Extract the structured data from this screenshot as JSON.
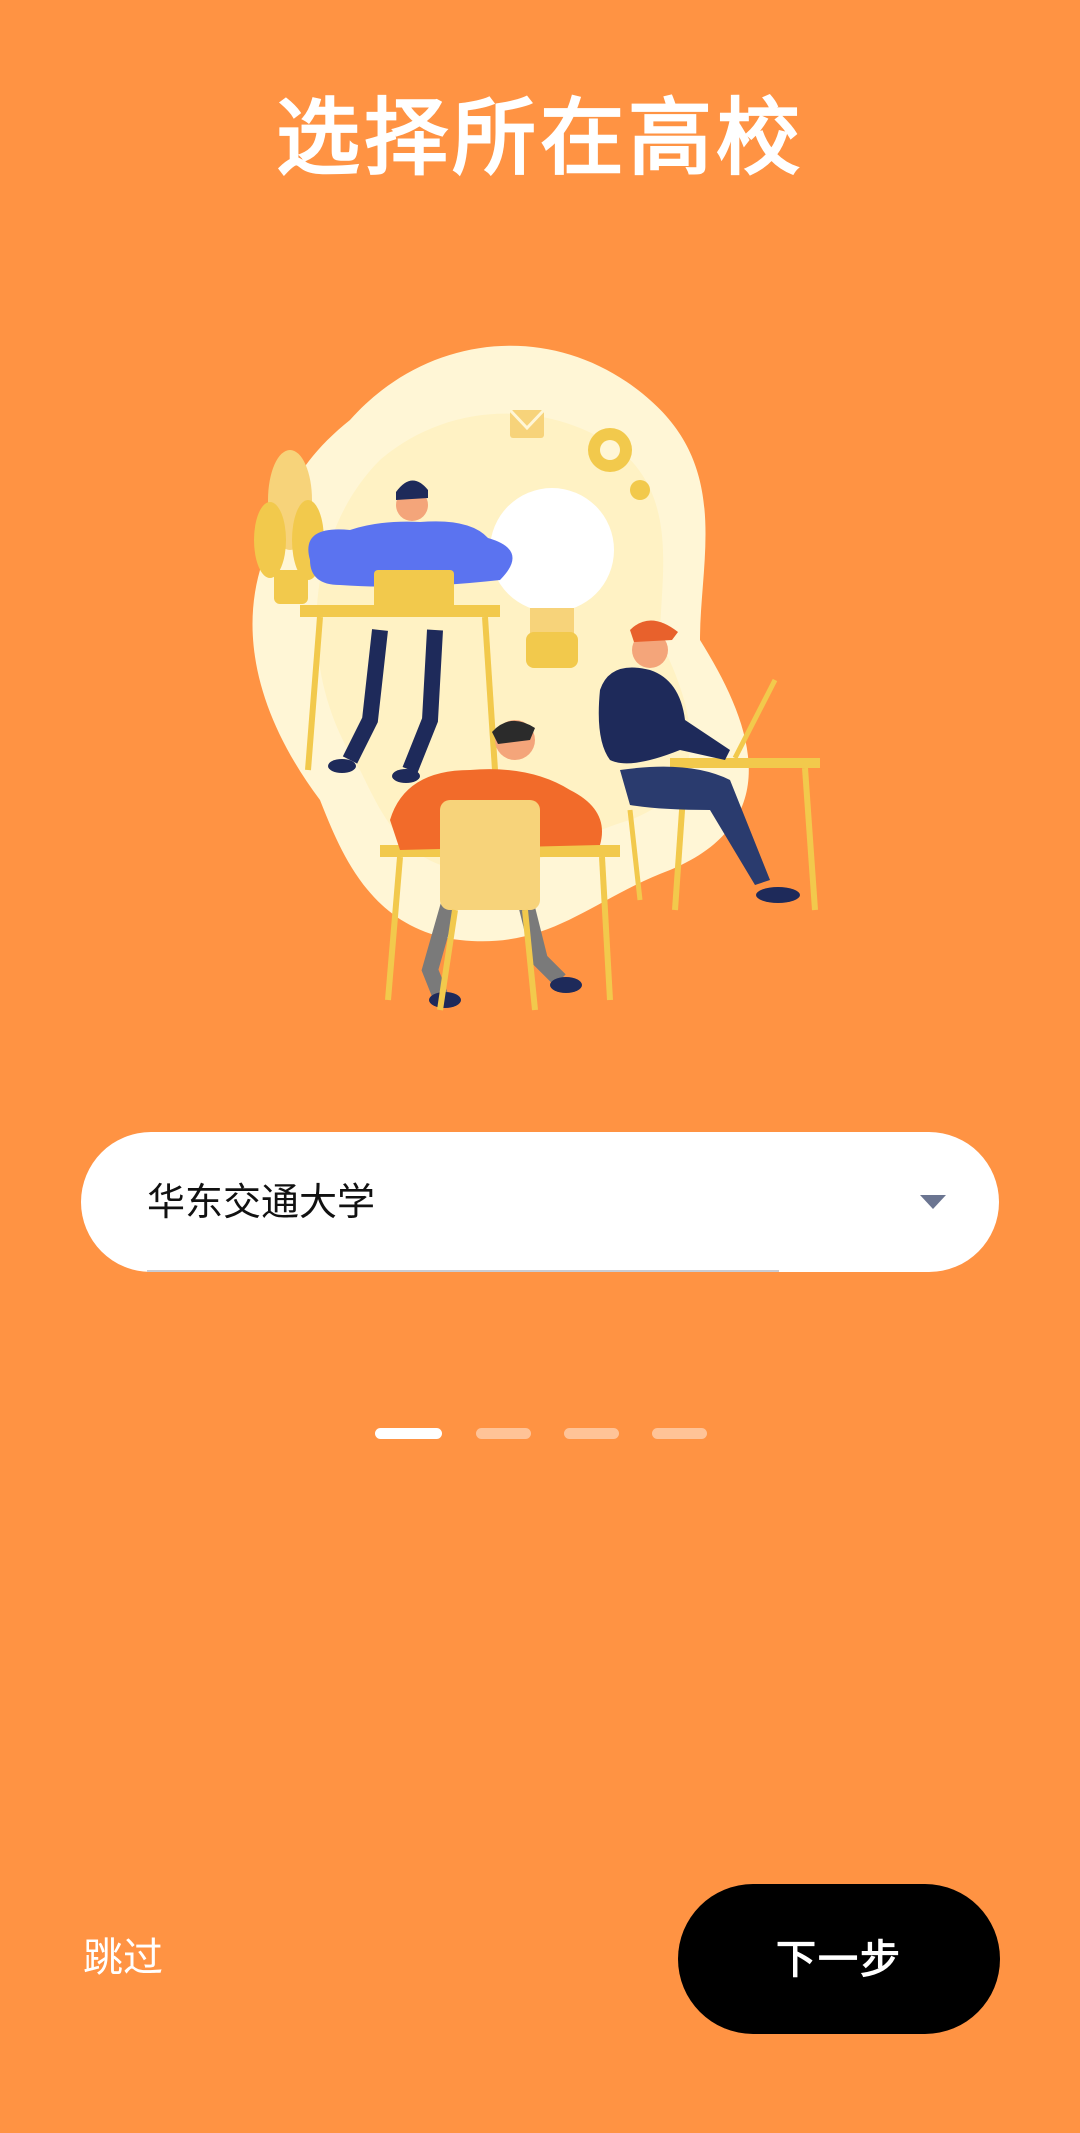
{
  "header": {
    "title": "选择所在高校"
  },
  "school_select": {
    "selected_value": "华东交通大学",
    "icon": "caret-down-icon"
  },
  "pager": {
    "total": 4,
    "active_index": 0
  },
  "footer": {
    "skip_label": "跳过",
    "next_label": "下一步"
  },
  "colors": {
    "background": "#FF9343",
    "primary_button": "#000000",
    "select_background": "#FFFFFF",
    "caret": "#6B7591"
  },
  "illustration": {
    "icon": "people-working-at-desks-illustration"
  }
}
